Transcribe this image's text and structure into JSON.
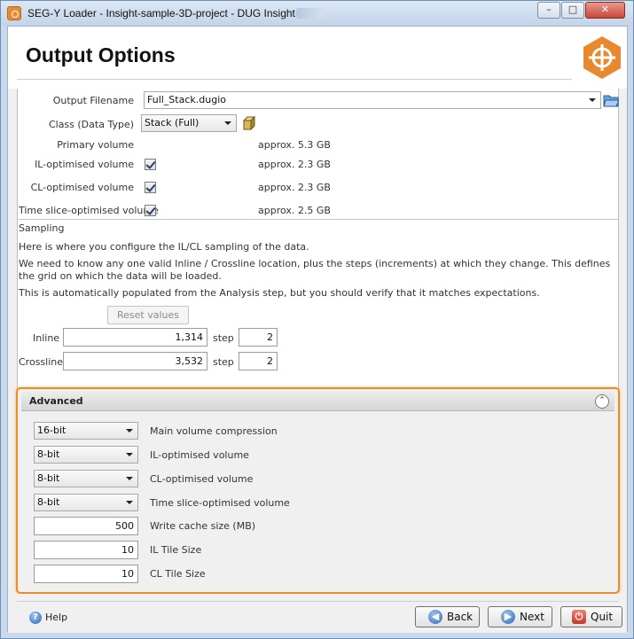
{
  "window": {
    "title": "SEG-Y Loader - Insight-sample-3D-project - DUG Insight",
    "minimize_glyph": "–",
    "maximize_glyph": "□",
    "close_glyph": "✕"
  },
  "header": {
    "page_title": "Output Options",
    "logo_icon": "dug-insight-logo-icon",
    "accent_color": "#e8892f"
  },
  "output": {
    "filename_label": "Output Filename",
    "filename_value": "Full_Stack.dugio",
    "browse_icon": "folder-open-icon",
    "class_label": "Class (Data Type)",
    "class_value": "Stack (Full)",
    "class_icon": "cube-icon",
    "volumes": [
      {
        "label": "Primary volume",
        "checked": null,
        "size": "approx. 5.3 GB"
      },
      {
        "label": "IL-optimised volume",
        "checked": true,
        "size": "approx. 2.3 GB"
      },
      {
        "label": "CL-optimised volume",
        "checked": true,
        "size": "approx. 2.3 GB"
      },
      {
        "label": "Time slice-optimised volume",
        "checked": true,
        "size": "approx. 2.5 GB"
      }
    ]
  },
  "sampling": {
    "section_label": "Sampling",
    "line1": "Here is where you configure the IL/CL sampling of the data.",
    "line2": "We need to know any one valid Inline / Crossline location, plus the steps (increments) at which they change. This defines the grid on which the data will be loaded.",
    "line3": "This is automatically populated from the Analysis step, but you should verify that it matches expectations.",
    "reset_label": "Reset values",
    "inline_label": "Inline",
    "inline_value": "1,314",
    "crossline_label": "Crossline",
    "crossline_value": "3,532",
    "step_label": "step",
    "inline_step": "2",
    "crossline_step": "2"
  },
  "advanced": {
    "title": "Advanced",
    "collapse_icon": "collapse-up-icon",
    "collapse_glyph": "⌃",
    "highlight_color": "#f08a24",
    "settings": [
      {
        "value": "16-bit",
        "label": "Main volume compression",
        "kind": "combo"
      },
      {
        "value": "8-bit",
        "label": "IL-optimised volume",
        "kind": "combo"
      },
      {
        "value": "8-bit",
        "label": "CL-optimised volume",
        "kind": "combo"
      },
      {
        "value": "8-bit",
        "label": "Time slice-optimised volume",
        "kind": "combo"
      },
      {
        "value": "500",
        "label": "Write cache size (MB)",
        "kind": "field"
      },
      {
        "value": "10",
        "label": "IL Tile Size",
        "kind": "field"
      },
      {
        "value": "10",
        "label": "CL Tile Size",
        "kind": "field"
      }
    ]
  },
  "footer": {
    "help_label": "Help",
    "help_glyph": "?",
    "back_label": "Back",
    "back_glyph": "◀",
    "next_label": "Next",
    "next_glyph": "▶",
    "quit_label": "Quit",
    "quit_glyph": "⏻"
  }
}
